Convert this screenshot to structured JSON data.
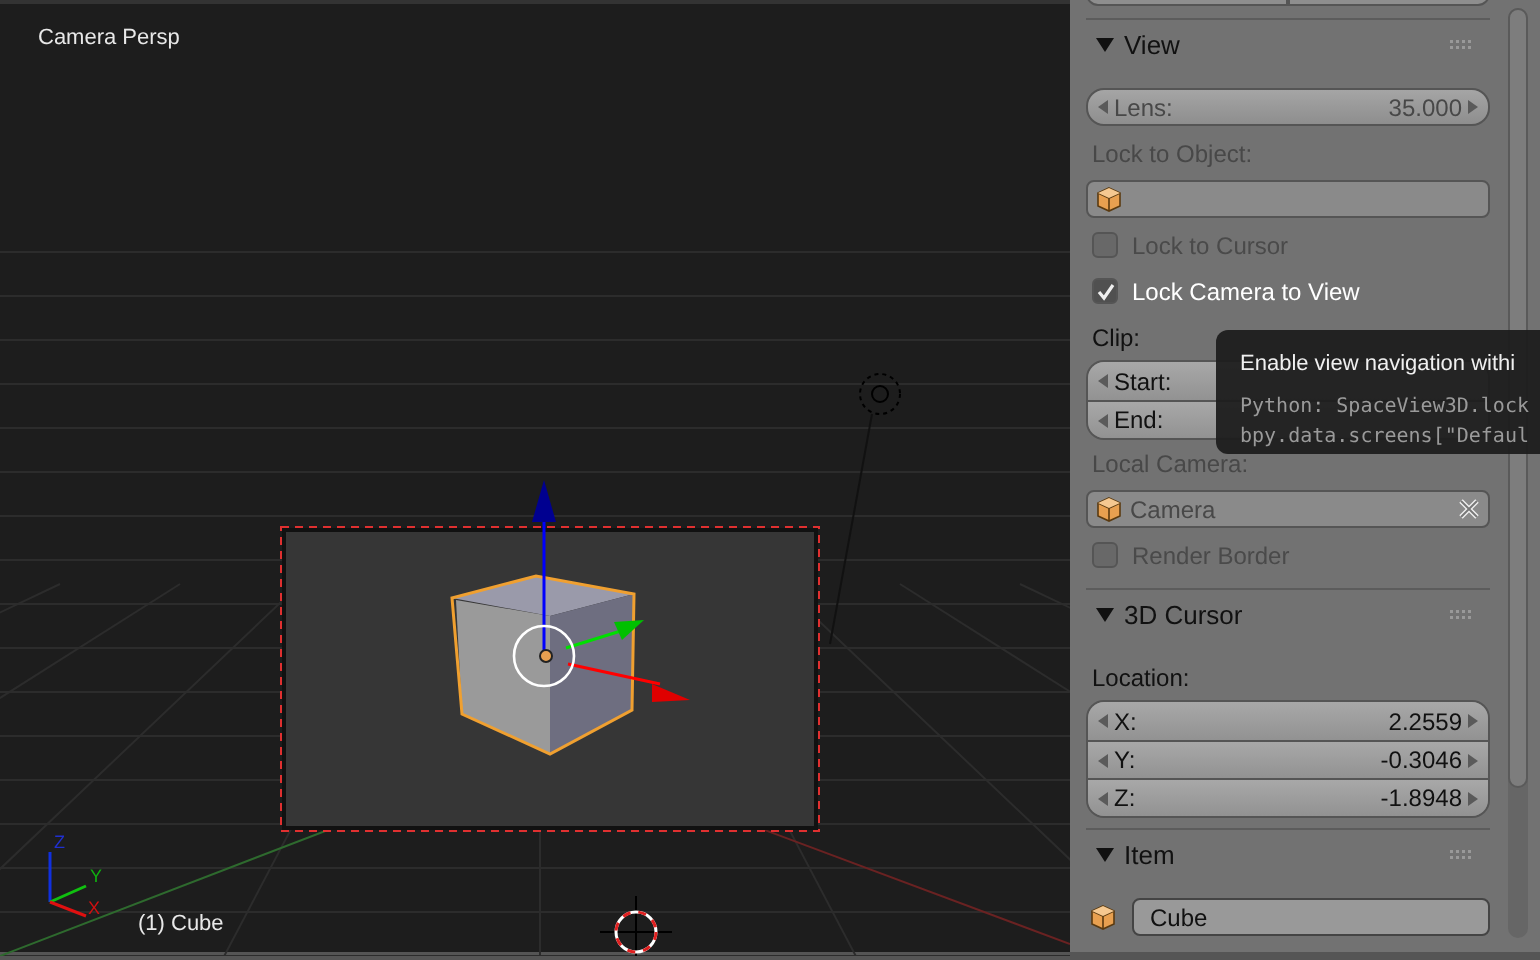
{
  "viewport": {
    "title": "Camera Persp",
    "object_label": "(1) Cube",
    "axes": [
      "Z",
      "Y",
      "X"
    ]
  },
  "properties": {
    "panels": [
      {
        "title": "View",
        "expanded": true,
        "rows": [
          {
            "kind": "number",
            "label": "Lens:",
            "value": "35.000",
            "dimmed": true
          },
          {
            "kind": "label",
            "text": "Lock to Object:",
            "dimmed": true
          },
          {
            "kind": "object_field",
            "dimmed": true
          },
          {
            "kind": "checkbox",
            "label": "Lock to Cursor",
            "checked": false,
            "dimmed": true
          },
          {
            "kind": "checkbox",
            "label": "Lock Camera to View",
            "checked": true,
            "dimmed": false
          },
          {
            "kind": "label",
            "text": "Clip:",
            "dimmed": false
          },
          {
            "kind": "number_group",
            "dimmed": false,
            "fields": [
              {
                "label": "Start:"
              },
              {
                "label": "End:"
              }
            ]
          },
          {
            "kind": "label",
            "text": "Local Camera:",
            "dimmed": true
          },
          {
            "kind": "object_field",
            "value": "Camera",
            "clearable": true,
            "dimmed": true
          },
          {
            "kind": "checkbox",
            "label": "Render Border",
            "checked": false,
            "dimmed": true
          }
        ]
      },
      {
        "title": "3D Cursor",
        "expanded": true,
        "rows": [
          {
            "kind": "label",
            "text": "Location:",
            "dimmed": false
          },
          {
            "kind": "number_group",
            "dimmed": false,
            "fields": [
              {
                "label": "X:",
                "value": "2.2559"
              },
              {
                "label": "Y:",
                "value": "-0.3046"
              },
              {
                "label": "Z:",
                "value": "-1.8948"
              }
            ]
          }
        ]
      },
      {
        "title": "Item",
        "expanded": true,
        "rows": [
          {
            "kind": "name_field",
            "value": "Cube",
            "dimmed": false
          }
        ]
      }
    ]
  },
  "tooltip": {
    "title": "Enable view navigation withi",
    "lines": [
      "Python: SpaceView3D.lock",
      "bpy.data.screens[\"Defaul"
    ]
  }
}
